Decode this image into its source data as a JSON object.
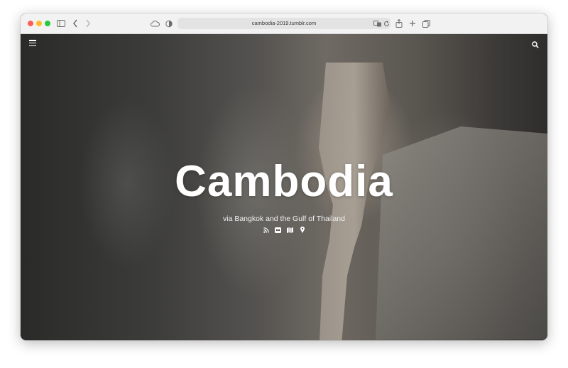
{
  "browser": {
    "url": "cambodia-2019.tumblr.com",
    "icons": [
      "sidebar-icon",
      "back-icon",
      "forward-icon",
      "icloud-icon",
      "privacy-shield-icon",
      "translate-icon",
      "reload-icon",
      "share-icon",
      "new-tab-icon",
      "tabs-overview-icon"
    ]
  },
  "page": {
    "title": "Cambodia",
    "subtitle": "via Bangkok and the Gulf of Thailand",
    "nav_icons": [
      "menu-icon",
      "search-icon"
    ],
    "social_icons": [
      "rss-icon",
      "flickr-icon",
      "map-icon",
      "location-pin-icon"
    ]
  },
  "colors": {
    "close": "#fe5f57",
    "minimize": "#febc2e",
    "zoom": "#28c840",
    "title_text": "#ffffff"
  }
}
